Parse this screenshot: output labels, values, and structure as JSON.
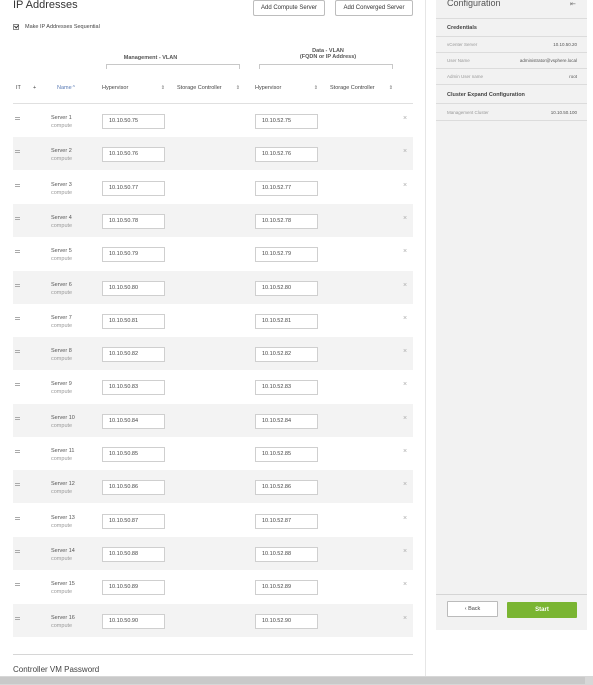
{
  "header": {
    "title": "IP Addresses",
    "add_compute_label": "Add Compute Server",
    "add_converged_label": "Add Converged Server"
  },
  "sequential_checkbox": {
    "label": "Make IP Addresses Sequential",
    "checked": true
  },
  "vlans": {
    "management": {
      "title": "Management - VLAN"
    },
    "data": {
      "title": "Data - VLAN",
      "subtitle": "(FQDN or IP Address)"
    }
  },
  "columns": {
    "index": "IT",
    "name": "Name",
    "hypervisor": "Hypervisor",
    "storage_controller": "Storage Controller",
    "data_hypervisor": "Hypervisor",
    "data_storage_controller": "Storage Controller"
  },
  "servers": [
    {
      "name": "Server 1",
      "role": "compute",
      "mgmt_ip": "10.10.50.75",
      "data_ip": "10.10.52.75"
    },
    {
      "name": "Server 2",
      "role": "compute",
      "mgmt_ip": "10.10.50.76",
      "data_ip": "10.10.52.76"
    },
    {
      "name": "Server 3",
      "role": "compute",
      "mgmt_ip": "10.10.50.77",
      "data_ip": "10.10.52.77"
    },
    {
      "name": "Server 4",
      "role": "compute",
      "mgmt_ip": "10.10.50.78",
      "data_ip": "10.10.52.78"
    },
    {
      "name": "Server 5",
      "role": "compute",
      "mgmt_ip": "10.10.50.79",
      "data_ip": "10.10.52.79"
    },
    {
      "name": "Server 6",
      "role": "compute",
      "mgmt_ip": "10.10.50.80",
      "data_ip": "10.10.52.80"
    },
    {
      "name": "Server 7",
      "role": "compute",
      "mgmt_ip": "10.10.50.81",
      "data_ip": "10.10.52.81"
    },
    {
      "name": "Server 8",
      "role": "compute",
      "mgmt_ip": "10.10.50.82",
      "data_ip": "10.10.52.82"
    },
    {
      "name": "Server 9",
      "role": "compute",
      "mgmt_ip": "10.10.50.83",
      "data_ip": "10.10.52.83"
    },
    {
      "name": "Server 10",
      "role": "compute",
      "mgmt_ip": "10.10.50.84",
      "data_ip": "10.10.52.84"
    },
    {
      "name": "Server 11",
      "role": "compute",
      "mgmt_ip": "10.10.50.85",
      "data_ip": "10.10.52.85"
    },
    {
      "name": "Server 12",
      "role": "compute",
      "mgmt_ip": "10.10.50.86",
      "data_ip": "10.10.52.86"
    },
    {
      "name": "Server 13",
      "role": "compute",
      "mgmt_ip": "10.10.50.87",
      "data_ip": "10.10.52.87"
    },
    {
      "name": "Server 14",
      "role": "compute",
      "mgmt_ip": "10.10.50.88",
      "data_ip": "10.10.52.88"
    },
    {
      "name": "Server 15",
      "role": "compute",
      "mgmt_ip": "10.10.50.89",
      "data_ip": "10.10.52.89"
    },
    {
      "name": "Server 16",
      "role": "compute",
      "mgmt_ip": "10.10.50.90",
      "data_ip": "10.10.52.90"
    }
  ],
  "controller_vm": {
    "title": "Controller VM Password"
  },
  "config_panel": {
    "title": "Configuration",
    "credentials": {
      "title": "Credentials",
      "vcenter_server_label": "vCenter Server",
      "vcenter_server_value": "10.10.50.20",
      "user_name_label": "User Name",
      "user_name_value": "administrator@vsphere.local",
      "admin_user_label": "Admin User name",
      "admin_user_value": "root"
    },
    "cluster_expand": {
      "title": "Cluster Expand Configuration",
      "mgmt_cluster_label": "Management Cluster",
      "mgmt_cluster_value": "10.10.50.100"
    },
    "back_label": "Back",
    "start_label": "Start"
  },
  "colors": {
    "start_button": "#7ab532",
    "name_header": "#5a7bb5",
    "panel_bg": "#f2f2f2"
  }
}
